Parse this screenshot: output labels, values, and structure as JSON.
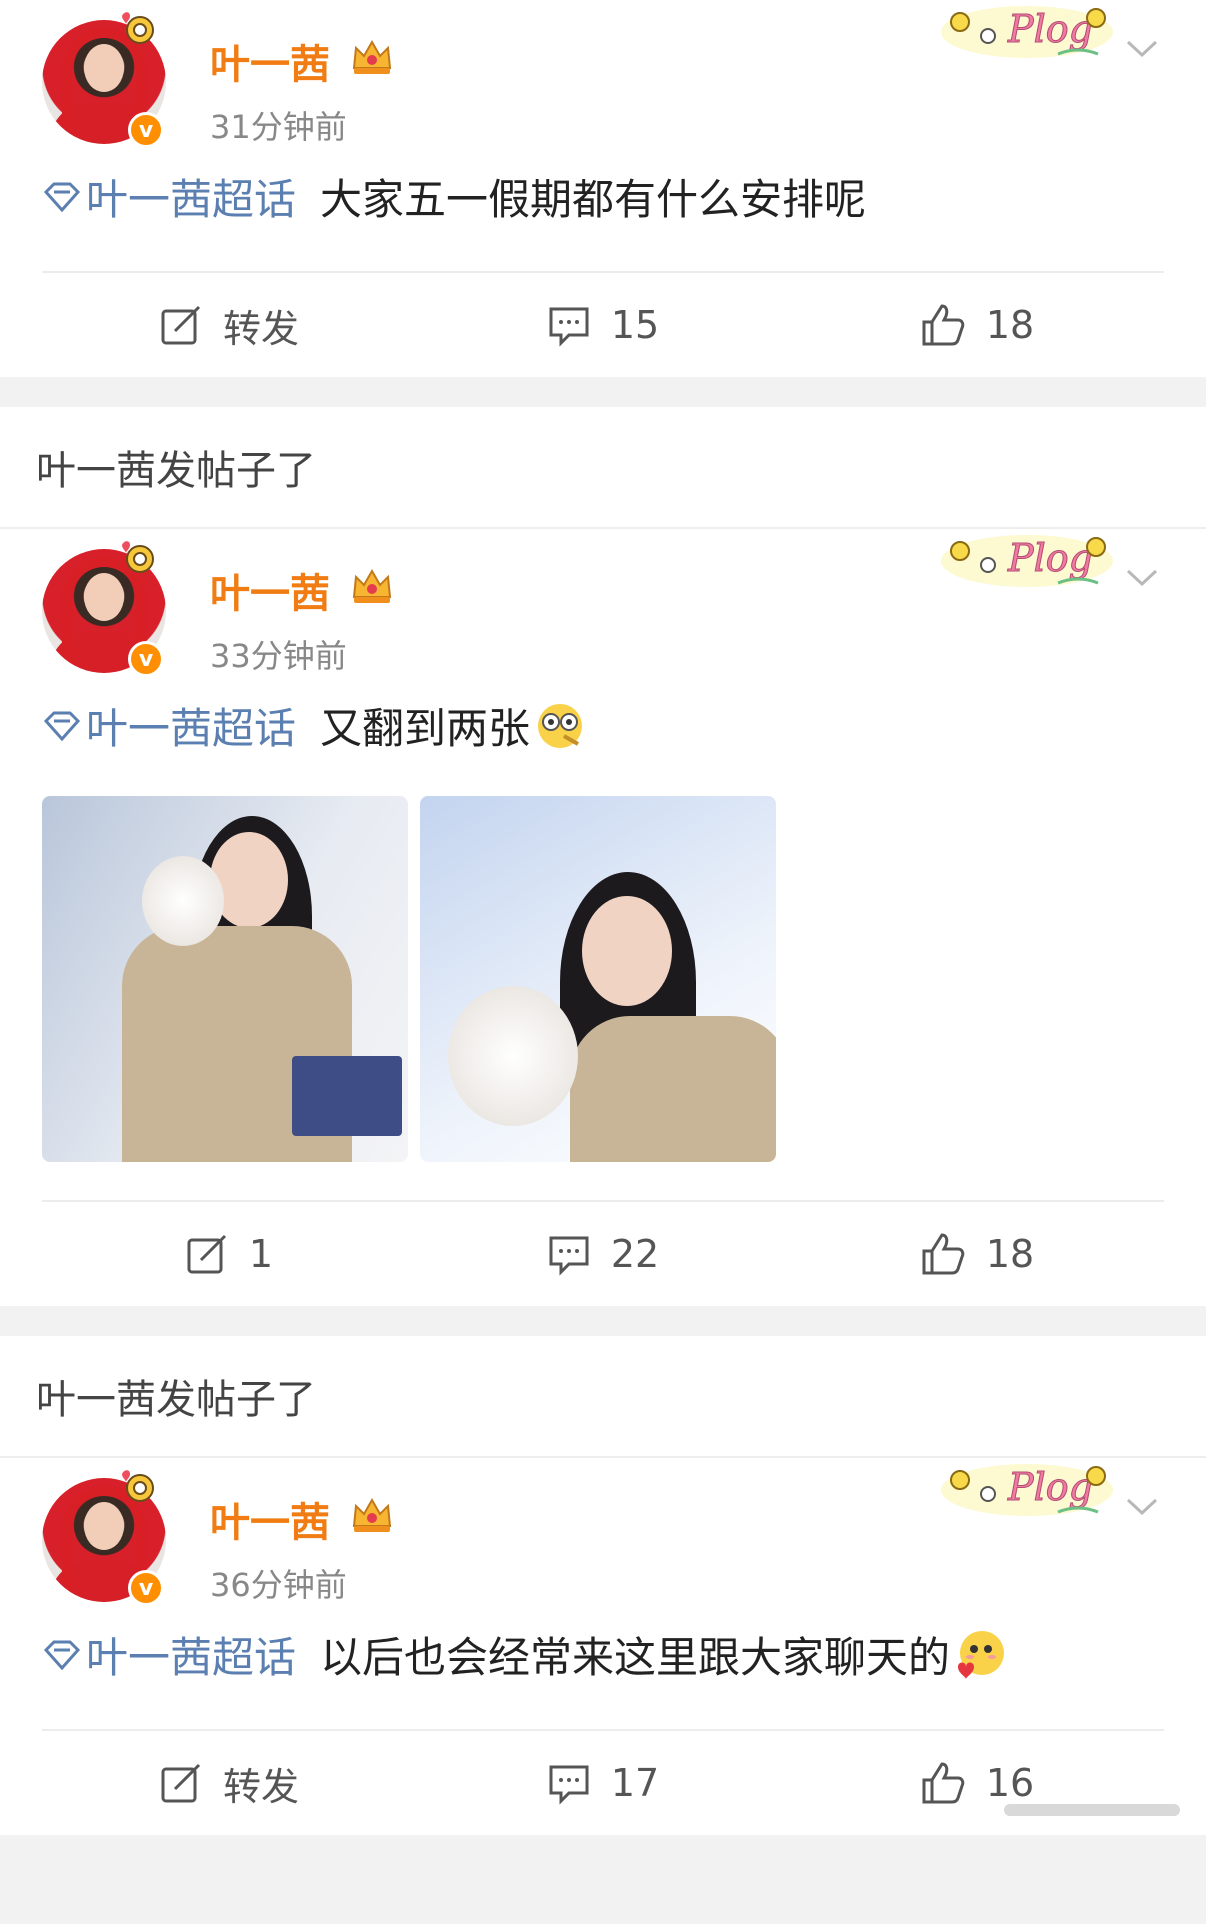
{
  "posts": [
    {
      "username": "叶一茜",
      "time": "31分钟前",
      "topic": "叶一茜超话",
      "text": "大家五一假期都有什么安排呢",
      "repost_label": "转发",
      "comments": "15",
      "likes": "18",
      "emoji": ""
    },
    {
      "notice": "叶一茜发帖子了",
      "username": "叶一茜",
      "time": "33分钟前",
      "topic": "叶一茜超话",
      "text": "又翻到两张",
      "repost_label": "1",
      "comments": "22",
      "likes": "18",
      "emoji": "glasses-face-emoji"
    },
    {
      "notice": "叶一茜发帖子了",
      "username": "叶一茜",
      "time": "36分钟前",
      "topic": "叶一茜超话",
      "text": "以后也会经常来这里跟大家聊天的",
      "repost_label": "转发",
      "comments": "17",
      "likes": "16",
      "emoji": "heart-face-emoji"
    }
  ],
  "colors": {
    "username": "#f07c13",
    "topic": "#5b7fb0",
    "verified": "#ff8f00"
  }
}
